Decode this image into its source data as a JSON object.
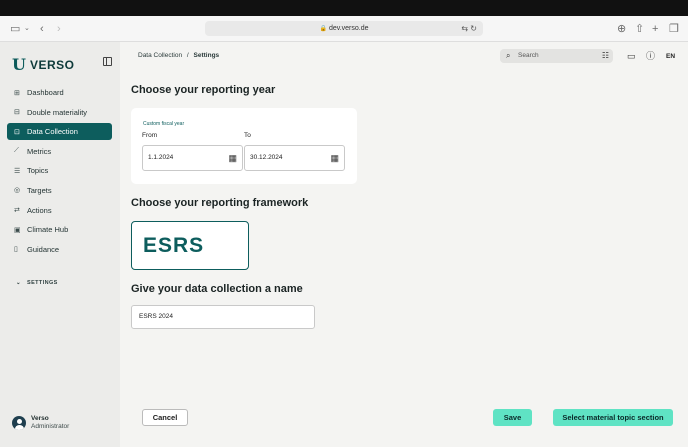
{
  "browser": {
    "url": "dev.verso.de"
  },
  "sidebar": {
    "brand": "VERSO",
    "items": [
      {
        "label": "Dashboard",
        "icon": "dashboard-icon"
      },
      {
        "label": "Double materiality",
        "icon": "materiality-icon"
      },
      {
        "label": "Data Collection",
        "icon": "data-collection-icon",
        "active": true
      },
      {
        "label": "Metrics",
        "icon": "metrics-icon"
      },
      {
        "label": "Topics",
        "icon": "topics-icon"
      },
      {
        "label": "Targets",
        "icon": "targets-icon"
      },
      {
        "label": "Actions",
        "icon": "actions-icon"
      },
      {
        "label": "Climate Hub",
        "icon": "climate-hub-icon"
      },
      {
        "label": "Guidance",
        "icon": "guidance-icon"
      }
    ],
    "settings_label": "SETTINGS",
    "user": {
      "name": "Verso",
      "role": "Administrator"
    }
  },
  "header": {
    "breadcrumb_parent": "Data Collection",
    "breadcrumb_sep": "/",
    "breadcrumb_current": "Settings",
    "search_placeholder": "Search",
    "language": "EN"
  },
  "main": {
    "year_heading": "Choose your reporting year",
    "fiscal_chip": "Custom fiscal year",
    "from_label": "From",
    "to_label": "To",
    "from_value": "1.1.2024",
    "to_value": "30.12.2024",
    "framework_heading": "Choose your reporting framework",
    "framework_option": "ESRS",
    "name_heading": "Give your data collection a name",
    "name_value": "ESRS 2024"
  },
  "actions": {
    "cancel": "Cancel",
    "save": "Save",
    "select_topic": "Select material topic section"
  },
  "colors": {
    "accent": "#0d5d5d",
    "button": "#5fe3c4"
  }
}
